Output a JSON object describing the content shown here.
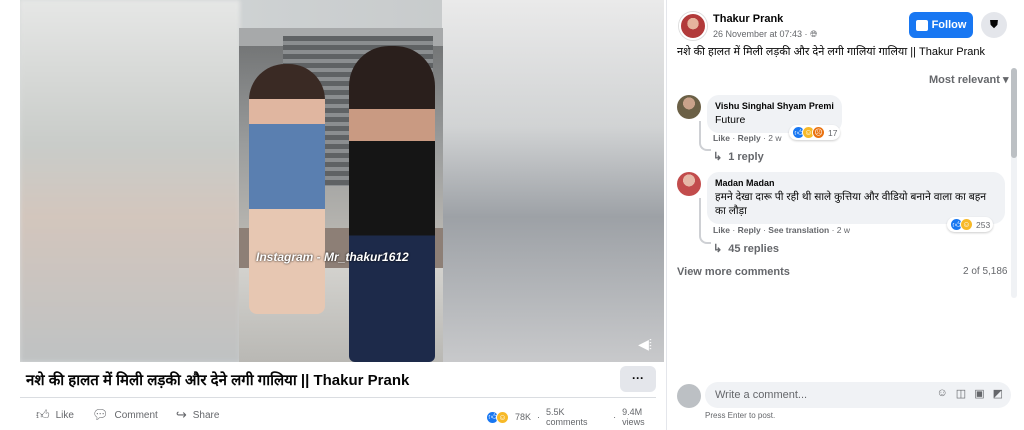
{
  "post": {
    "title": "नशे की हालत में मिली लड़की और देने लगी गालिया || Thakur Prank",
    "watermark": "Instagram - Mr_thakur1612",
    "more_label": "···",
    "actions": {
      "like": "Like",
      "comment": "Comment",
      "share": "Share"
    },
    "stats": {
      "reactions": "78K",
      "comments": "5.5K comments",
      "views": "9.4M views"
    }
  },
  "sidebar": {
    "page_name": "Thakur Prank",
    "date": "26 November at 07:43 · ",
    "follow_label": "Follow",
    "post_text": "नशे की हालत में मिली लड़की और देने लगी गालियां गालिया || Thakur Prank",
    "sort_label": "Most relevant",
    "comments": [
      {
        "author": "Vishu Singhal Shyam Premi",
        "text": "Future",
        "like": "Like",
        "reply": "Reply",
        "age": "2 w",
        "reaction_count": "17",
        "replies_label": "1 reply"
      },
      {
        "author": "Madan Madan",
        "text": "हमने देखा दारू पी रही थी साले कुत्तिया और वीडियो बनाने वाला का बहन का लौड़ा",
        "like": "Like",
        "reply": "Reply",
        "translation": "See translation",
        "age": "2 w",
        "reaction_count": "253",
        "replies_label": "45 replies"
      }
    ],
    "view_more_label": "View more comments",
    "comment_count": "2 of 5,186",
    "write_placeholder": "Write a comment...",
    "enter_hint": "Press Enter to post."
  },
  "colors": {
    "accent": "#1877f2",
    "muted_text": "#65676b",
    "bubble_bg": "#f0f2f5"
  }
}
